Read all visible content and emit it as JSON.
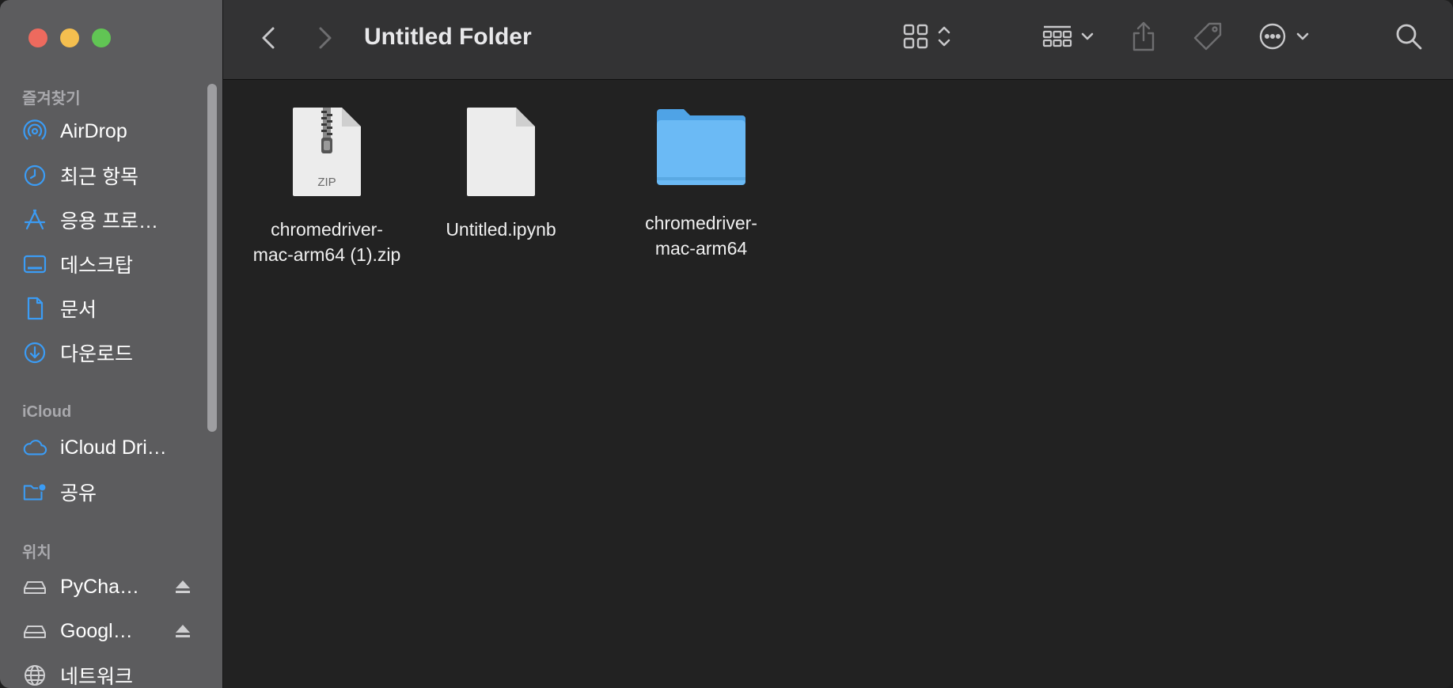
{
  "window": {
    "title": "Untitled Folder"
  },
  "sidebar": {
    "favorites_header": "즐겨찾기",
    "favorites": [
      {
        "label": "AirDrop",
        "icon": "airdrop-icon"
      },
      {
        "label": "최근 항목",
        "icon": "clock-icon"
      },
      {
        "label": "응용 프로…",
        "icon": "applications-icon"
      },
      {
        "label": "데스크탑",
        "icon": "desktop-icon"
      },
      {
        "label": "문서",
        "icon": "document-icon"
      },
      {
        "label": "다운로드",
        "icon": "download-icon"
      }
    ],
    "icloud_header": "iCloud",
    "icloud": [
      {
        "label": "iCloud Dri…",
        "icon": "cloud-icon"
      },
      {
        "label": "공유",
        "icon": "shared-folder-icon"
      }
    ],
    "locations_header": "위치",
    "locations": [
      {
        "label": "PyCha…",
        "icon": "drive-icon"
      },
      {
        "label": "Googl…",
        "icon": "drive-icon"
      },
      {
        "label": "네트워크",
        "icon": "network-icon"
      }
    ]
  },
  "files": [
    {
      "name_line1": "chromedriver-",
      "name_line2": "mac-arm64 (1).zip",
      "kind": "zip",
      "badge": "ZIP"
    },
    {
      "name_line1": "Untitled.ipynb",
      "name_line2": "",
      "kind": "document"
    },
    {
      "name_line1": "chromedriver-",
      "name_line2": "mac-arm64",
      "kind": "folder"
    }
  ],
  "colors": {
    "accent": "#3b9cf5",
    "folder": "#6bbaf5",
    "sidebar_bg": "#5c5c5e",
    "content_bg": "#222222"
  }
}
